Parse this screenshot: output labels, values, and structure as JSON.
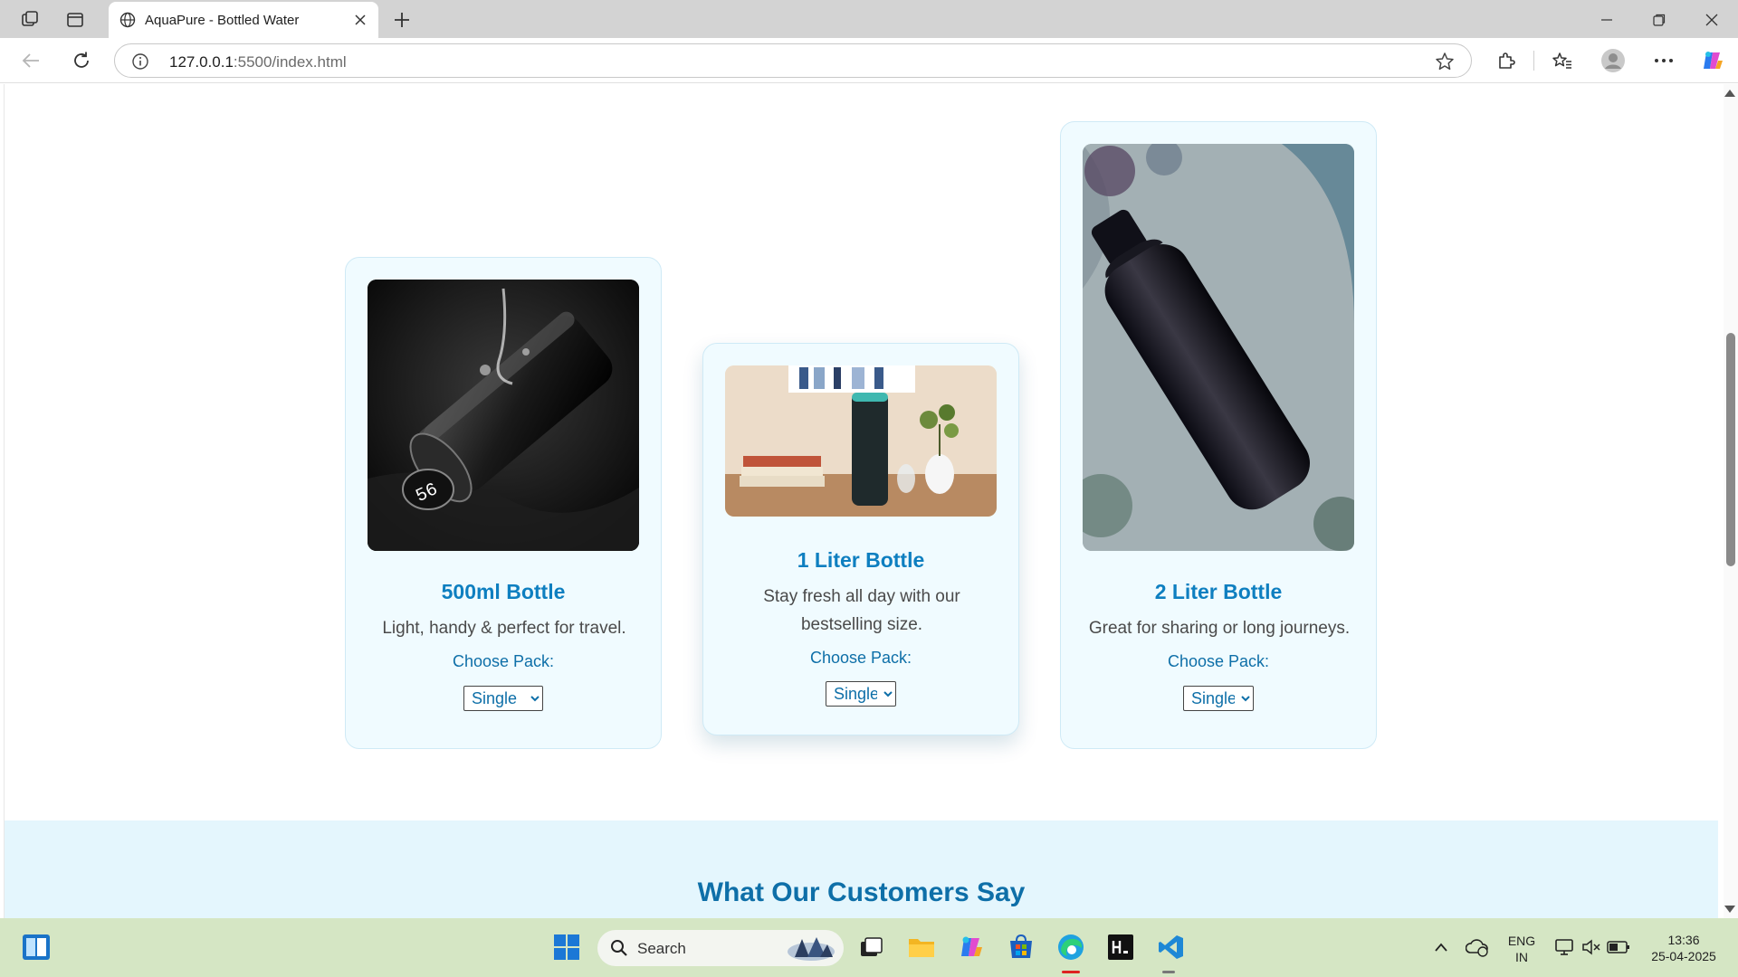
{
  "browser": {
    "tab_title": "AquaPure - Bottled Water",
    "url_host": "127.0.0.1",
    "url_rest": ":5500/index.html"
  },
  "products": [
    {
      "name": "500ml Bottle",
      "desc": "Light, handy & perfect for travel.",
      "pack_label": "Choose Pack:",
      "pack_value": "Single"
    },
    {
      "name": "1 Liter Bottle",
      "desc": "Stay fresh all day with our bestselling size.",
      "pack_label": "Choose Pack:",
      "pack_value": "Single"
    },
    {
      "name": "2 Liter Bottle",
      "desc": "Great for sharing or long journeys.",
      "pack_label": "Choose Pack:",
      "pack_value": "Single"
    }
  ],
  "testimonials": {
    "title": "What Our Customers Say"
  },
  "taskbar": {
    "search_label": "Search",
    "lang_top": "ENG",
    "lang_bottom": "IN",
    "time": "13:36",
    "date": "25-04-2025"
  },
  "colors": {
    "accent": "#0e7fc0",
    "card_bg": "#f0fbff",
    "section_bg": "#e4f6fd"
  }
}
